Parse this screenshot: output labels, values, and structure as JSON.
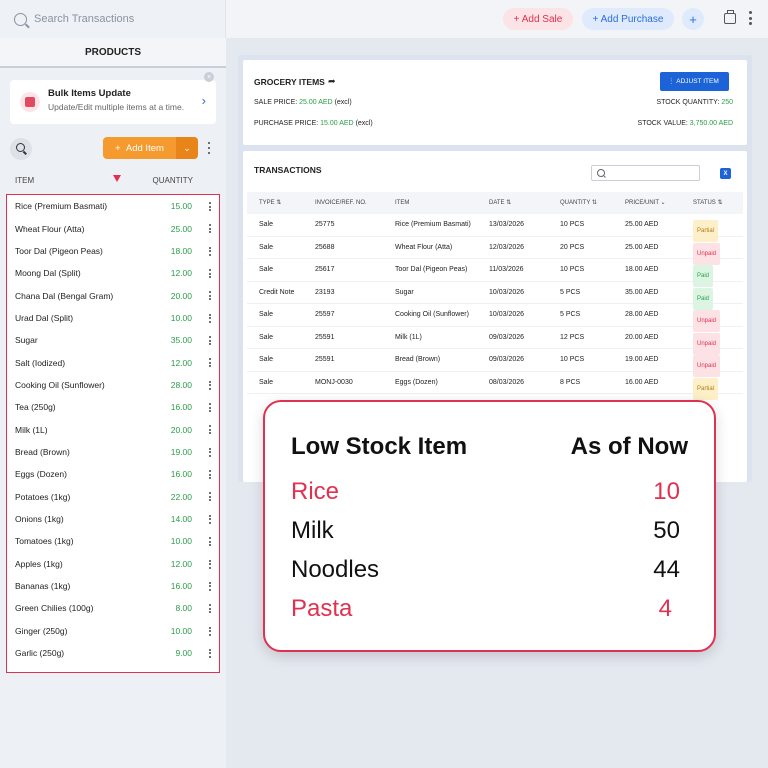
{
  "topbar": {
    "search_placeholder": "Search Transactions",
    "add_sale": "+ Add Sale",
    "add_purchase": "+ Add Purchase",
    "plus": "+"
  },
  "sidebar": {
    "tab": "PRODUCTS",
    "bulk": {
      "title": "Bulk Items Update",
      "subtitle": "Update/Edit multiple items at a time."
    },
    "add_item": "Add Item",
    "col_item": "ITEM",
    "col_qty": "QUANTITY",
    "items": [
      {
        "name": "Rice (Premium Basmati)",
        "qty": "15.00"
      },
      {
        "name": "Wheat Flour (Atta)",
        "qty": "25.00"
      },
      {
        "name": "Toor Dal (Pigeon Peas)",
        "qty": "18.00"
      },
      {
        "name": "Moong Dal (Split)",
        "qty": "12.00"
      },
      {
        "name": "Chana Dal (Bengal Gram)",
        "qty": "20.00"
      },
      {
        "name": "Urad Dal (Split)",
        "qty": "10.00"
      },
      {
        "name": "Sugar",
        "qty": "35.00"
      },
      {
        "name": "Salt (Iodized)",
        "qty": "12.00"
      },
      {
        "name": "Cooking Oil (Sunflower)",
        "qty": "28.00"
      },
      {
        "name": "Tea (250g)",
        "qty": "16.00"
      },
      {
        "name": "Milk (1L)",
        "qty": "20.00"
      },
      {
        "name": "Bread (Brown)",
        "qty": "19.00"
      },
      {
        "name": "Eggs (Dozen)",
        "qty": "16.00"
      },
      {
        "name": "Potatoes (1kg)",
        "qty": "22.00"
      },
      {
        "name": "Onions (1kg)",
        "qty": "14.00"
      },
      {
        "name": "Tomatoes (1kg)",
        "qty": "10.00"
      },
      {
        "name": "Apples (1kg)",
        "qty": "12.00"
      },
      {
        "name": "Bananas (1kg)",
        "qty": "16.00"
      },
      {
        "name": "Green Chilies (100g)",
        "qty": "8.00"
      },
      {
        "name": "Ginger (250g)",
        "qty": "10.00"
      },
      {
        "name": "Garlic (250g)",
        "qty": "9.00"
      }
    ]
  },
  "grocery": {
    "title": "GROCERY ITEMS",
    "adjust": "ADJUST ITEM",
    "sale_price_label": "SALE PRICE:",
    "sale_price_value": "25.00 AED",
    "sale_price_suffix": "(excl)",
    "purchase_price_label": "PURCHASE PRICE:",
    "purchase_price_value": "15.00 AED",
    "purchase_price_suffix": "(excl)",
    "stock_qty_label": "STOCK QUANTITY:",
    "stock_qty_value": "250",
    "stock_value_label": "STOCK VALUE:",
    "stock_value_value": "3,750.00 AED"
  },
  "transactions": {
    "title": "TRANSACTIONS",
    "headers": [
      "TYPE ⇅",
      "INVOICE/REF. NO.",
      "ITEM",
      "DATE ⇅",
      "QUANTITY ⇅",
      "PRICE/UNIT ⌄",
      "STATUS ⇅"
    ],
    "rows": [
      {
        "type": "Sale",
        "invoice": "25775",
        "item": "Rice (Premium Basmati)",
        "date": "13/03/2026",
        "qty": "10 PCS",
        "price": "25.00 AED",
        "status": "Partial"
      },
      {
        "type": "Sale",
        "invoice": "25688",
        "item": "Wheat Flour (Atta)",
        "date": "12/03/2026",
        "qty": "20 PCS",
        "price": "25.00 AED",
        "status": "Unpaid"
      },
      {
        "type": "Sale",
        "invoice": "25617",
        "item": "Toor Dal (Pigeon Peas)",
        "date": "11/03/2026",
        "qty": "10 PCS",
        "price": "18.00 AED",
        "status": "Paid"
      },
      {
        "type": "Credit Note",
        "invoice": "23193",
        "item": "Sugar",
        "date": "10/03/2026",
        "qty": "5 PCS",
        "price": "35.00 AED",
        "status": "Paid"
      },
      {
        "type": "Sale",
        "invoice": "25597",
        "item": "Cooking Oil (Sunflower)",
        "date": "10/03/2026",
        "qty": "5 PCS",
        "price": "28.00 AED",
        "status": "Unpaid"
      },
      {
        "type": "Sale",
        "invoice": "25591",
        "item": "Milk (1L)",
        "date": "09/03/2026",
        "qty": "12 PCS",
        "price": "20.00 AED",
        "status": "Unpaid"
      },
      {
        "type": "Sale",
        "invoice": "25591",
        "item": "Bread (Brown)",
        "date": "09/03/2026",
        "qty": "10 PCS",
        "price": "19.00 AED",
        "status": "Unpaid"
      },
      {
        "type": "Sale",
        "invoice": "MONJ-0030",
        "item": "Eggs (Dozen)",
        "date": "08/03/2026",
        "qty": "8 PCS",
        "price": "16.00 AED",
        "status": "Partial"
      }
    ]
  },
  "popup": {
    "header_left": "Low Stock Item",
    "header_right": "As of Now",
    "items": [
      {
        "name": "Rice",
        "value": "10",
        "color": "#e03150"
      },
      {
        "name": "Milk",
        "value": "50",
        "color": "#111111"
      },
      {
        "name": "Noodles",
        "value": "44",
        "color": "#111111"
      },
      {
        "name": "Pasta",
        "value": "4",
        "color": "#e03150"
      }
    ]
  },
  "colors": {
    "accent_red": "#e03150",
    "accent_blue": "#1b63d6",
    "add_item_orange": "#f59a2f",
    "qty_green": "#2a9d4a"
  }
}
